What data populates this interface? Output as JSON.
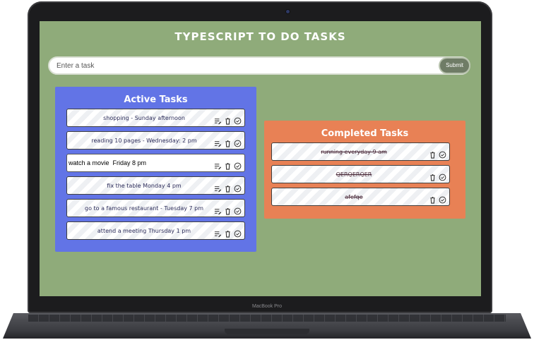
{
  "device": {
    "bezel_label": "MacBook Pro"
  },
  "app": {
    "title": "TYPESCRIPT TO DO TASKS"
  },
  "form": {
    "placeholder": "Enter a task",
    "submit_label": "Submit"
  },
  "active": {
    "title": "Active Tasks",
    "tasks": [
      {
        "text": "shopping - Sunday afternoon"
      },
      {
        "text": "reading 10 pages - Wednesday: 2 pm"
      },
      {
        "text": "watch a movie  Friday 8 pm",
        "editing": true
      },
      {
        "text": "fix the table Monday 4 pm"
      },
      {
        "text": "go to a famous restaurant - Tuesday 7 pm"
      },
      {
        "text": "attend a meeting Thursday 1 pm"
      }
    ]
  },
  "completed": {
    "title": "Completed Tasks",
    "tasks": [
      {
        "text": "running everyday 9 am"
      },
      {
        "text": "QERQERQER"
      },
      {
        "text": "afefqe"
      }
    ]
  },
  "icons": {
    "edit": "edit-icon",
    "delete": "trash-icon",
    "done": "check-circle-icon"
  },
  "colors": {
    "screen_bg": "#8fab7a",
    "active_panel": "#6274e6",
    "completed_panel": "#e88155",
    "submit": "#6f7c66"
  }
}
